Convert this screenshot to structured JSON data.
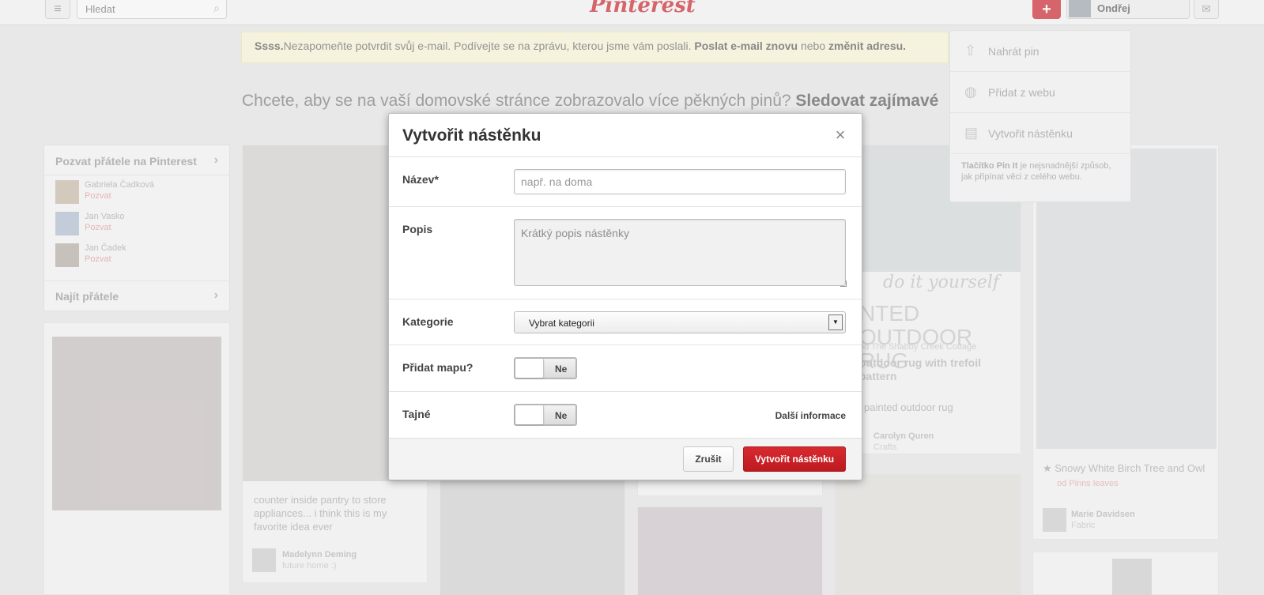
{
  "header": {
    "search_placeholder": "Hledat",
    "logo": "Pinterest",
    "user_name": "Ondřej"
  },
  "alert": {
    "lead": "Ssss.",
    "text": "Nezapomeňte potvrdit svůj e-mail. Podívejte se na zprávu, kterou jsme vám poslali.",
    "resend": "Poslat e-mail znovu",
    "or": "nebo",
    "change": "změnit adresu."
  },
  "follow_prompt": {
    "text": "Chcete, aby se na vaší domovské stránce zobrazovalo více pěkných pinů?",
    "link": "Sledovat zajímavé"
  },
  "add_menu": {
    "items": [
      "Nahrát pin",
      "Přidat z webu",
      "Vytvořit nástěnku"
    ],
    "tip_bold": "Tlačítko Pin It",
    "tip_text": "je nejsnadnější způsob, jak připínat věci z celého webu."
  },
  "invite": {
    "title": "Pozvat přátele na Pinterest",
    "friends": [
      {
        "name": "Gabriela Čadková",
        "action": "Pozvat"
      },
      {
        "name": "Jan Vasko",
        "action": "Pozvat"
      },
      {
        "name": "Jan Čadek",
        "action": "Pozvat"
      }
    ],
    "find": "Najít přátele"
  },
  "pins": {
    "pantry_desc": "counter inside pantry to store appliances... i think this is my favorite idea ever",
    "pantry_user": "Madelynn Deming",
    "pantry_board": "future home :)",
    "rug_script": "do it yourself",
    "rug_title": "NTED OUTDOOR RUG",
    "rug_source": "od The Shabby Creek Cottage",
    "rug_headline": "outdoor rug with trefoil pattern",
    "rug_desc": "painted outdoor rug",
    "rug_user": "Carolyn Quren",
    "rug_board": "Crafts",
    "owl_desc": "★ Snowy White Birch Tree and Owl",
    "owl_via": "od Pinns leaves",
    "owl_user": "Marie Davidsen",
    "owl_board": "Fabric"
  },
  "modal": {
    "title": "Vytvořit nástěnku",
    "name_label": "Název*",
    "name_placeholder": "např. na doma",
    "desc_label": "Popis",
    "desc_placeholder": "Krátký popis nástěnky",
    "category_label": "Kategorie",
    "category_value": "Vybrat kategorii",
    "map_label": "Přidat mapu?",
    "map_state": "Ne",
    "secret_label": "Tajné",
    "secret_state": "Ne",
    "more_info": "Další informace",
    "cancel": "Zrušit",
    "create": "Vytvořit nástěnku"
  },
  "colors": {
    "brand": "#cb2027",
    "alert_bg": "#fcf8d8"
  }
}
